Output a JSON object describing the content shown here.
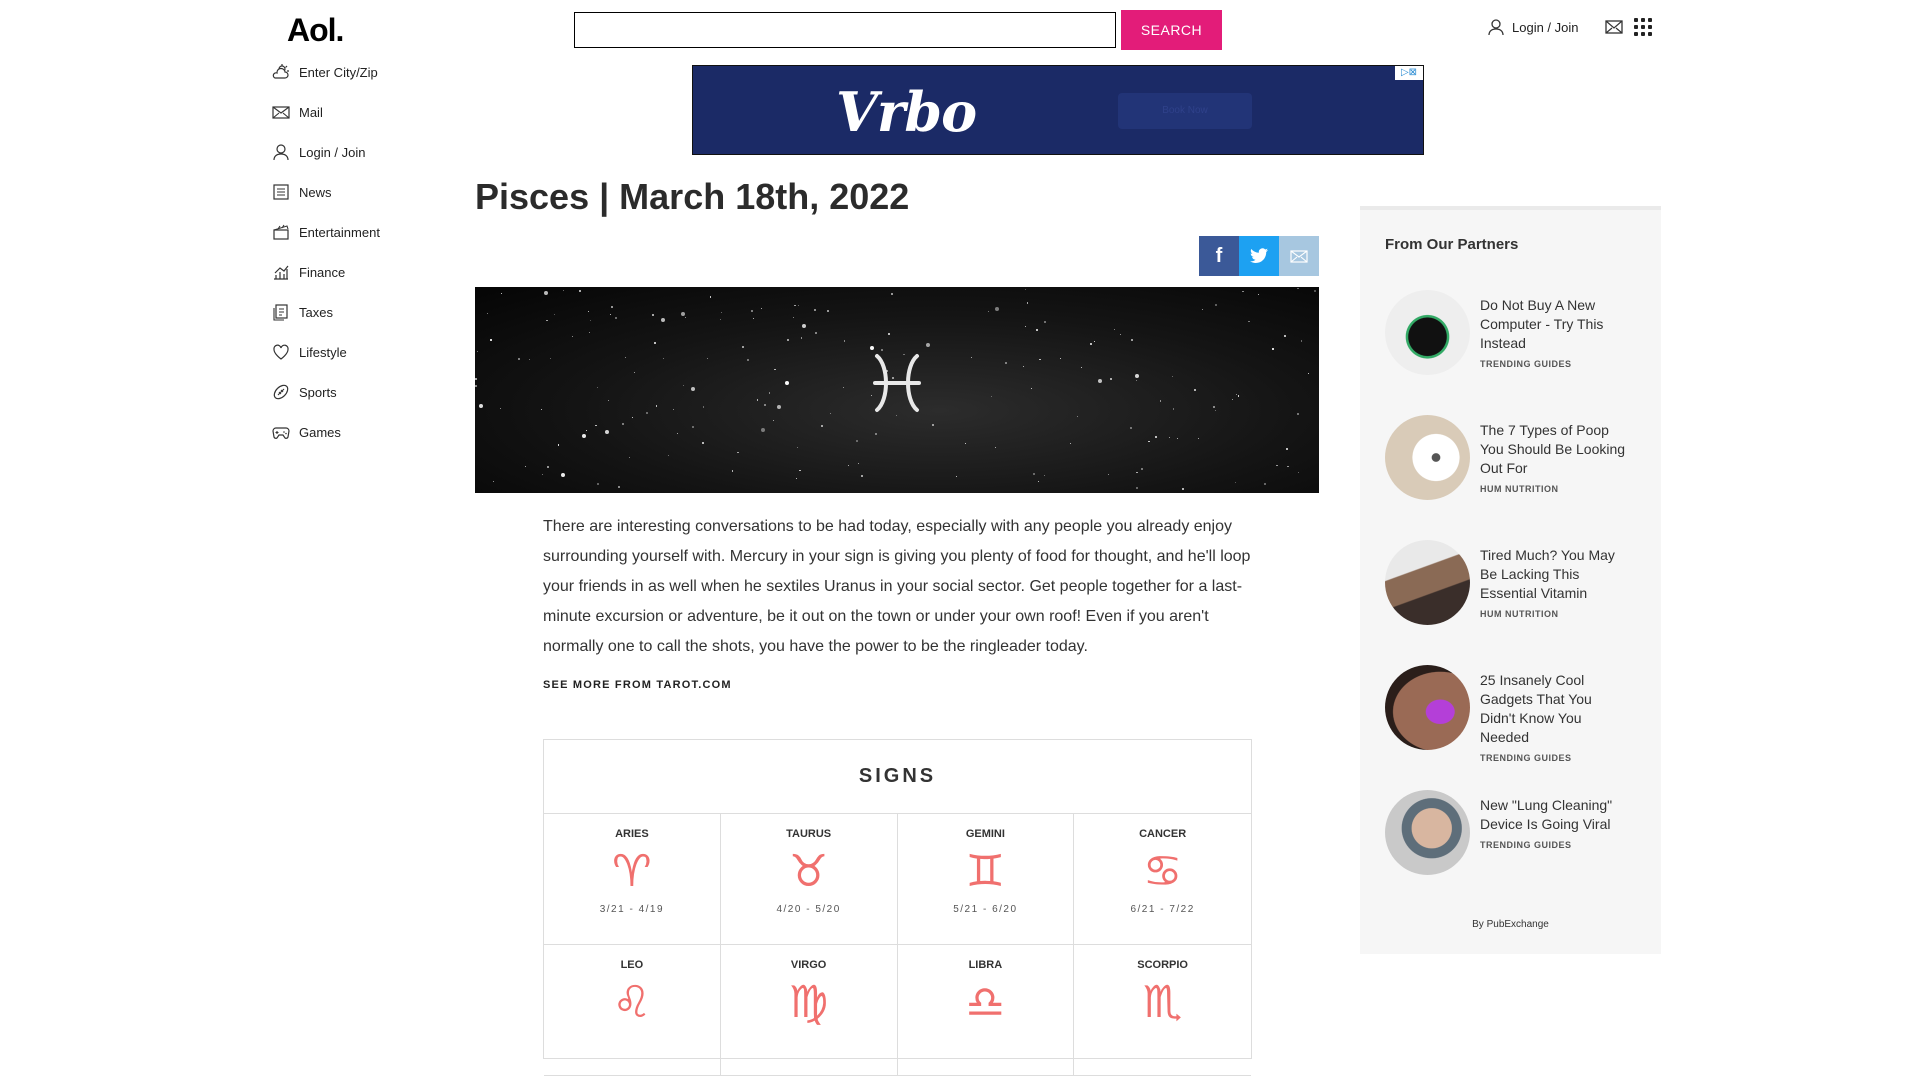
{
  "header": {
    "logo": "Aol.",
    "search_placeholder": "",
    "search_button": "SEARCH",
    "login_label": "Login / Join"
  },
  "sidebar": {
    "items": [
      {
        "label": "Enter City/Zip",
        "icon": "weather-icon"
      },
      {
        "label": "Mail",
        "icon": "mail-icon"
      },
      {
        "label": "Login / Join",
        "icon": "user-icon"
      },
      {
        "label": "News",
        "icon": "news-icon"
      },
      {
        "label": "Entertainment",
        "icon": "clapperboard-icon"
      },
      {
        "label": "Finance",
        "icon": "finance-chart-icon"
      },
      {
        "label": "Taxes",
        "icon": "taxes-document-icon"
      },
      {
        "label": "Lifestyle",
        "icon": "heart-icon"
      },
      {
        "label": "Sports",
        "icon": "football-icon"
      },
      {
        "label": "Games",
        "icon": "gamepad-icon"
      }
    ]
  },
  "ad": {
    "brand": "Vrbo",
    "button": "Book Now"
  },
  "article": {
    "title": "Pisces | March 18th, 2022",
    "body": "There are interesting conversations to be had today, especially with any people you already enjoy surrounding yourself with. Mercury in your sign is giving you plenty of food for thought, and he'll loop your friends in as well when he sextiles Uranus in your social sector. Get people together for a last-minute excursion or adventure, be it out on the town or under your own roof! Even if you aren't normally one to call the shots, you have the power to be the ringleader today.",
    "more_link": "SEE MORE FROM TAROT.COM",
    "hero_glyph": "♓"
  },
  "signs": {
    "title": "SIGNS",
    "items": [
      {
        "name": "ARIES",
        "glyph": "♈",
        "dates": "3/21 - 4/19"
      },
      {
        "name": "TAURUS",
        "glyph": "♉",
        "dates": "4/20 - 5/20"
      },
      {
        "name": "GEMINI",
        "glyph": "♊",
        "dates": "5/21 - 6/20"
      },
      {
        "name": "CANCER",
        "glyph": "♋",
        "dates": "6/21 - 7/22"
      },
      {
        "name": "LEO",
        "glyph": "♌",
        "dates": ""
      },
      {
        "name": "VIRGO",
        "glyph": "♍",
        "dates": ""
      },
      {
        "name": "LIBRA",
        "glyph": "♎",
        "dates": ""
      },
      {
        "name": "SCORPIO",
        "glyph": "♏",
        "dates": ""
      }
    ]
  },
  "partners": {
    "heading": "From Our Partners",
    "byline": "By PubExchange",
    "items": [
      {
        "title": "Do Not Buy A New Computer - Try This Instead",
        "source": "TRENDING GUIDES"
      },
      {
        "title": "The 7 Types of Poop You Should Be Looking Out For",
        "source": "HUM NUTRITION"
      },
      {
        "title": "Tired Much? You May Be Lacking This Essential Vitamin",
        "source": "HUM NUTRITION"
      },
      {
        "title": "25 Insanely Cool Gadgets That You Didn't Know You Needed",
        "source": "TRENDING GUIDES"
      },
      {
        "title": "New \"Lung Cleaning\" Device Is Going Viral",
        "source": "TRENDING GUIDES"
      }
    ]
  },
  "colors": {
    "accent": "#e31c79",
    "sign_glyph": "#f0706e",
    "facebook": "#3b5998",
    "twitter": "#1da1f2",
    "email": "#a7c7e0"
  }
}
